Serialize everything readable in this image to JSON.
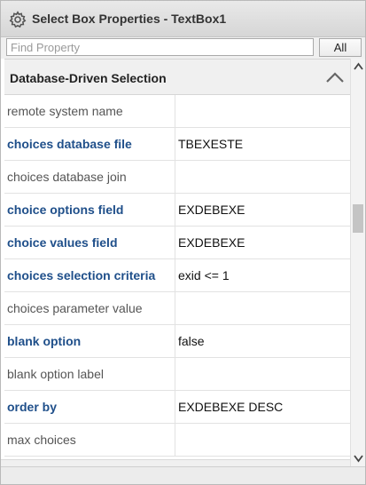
{
  "window": {
    "title": "Select Box Properties - TextBox1",
    "icon": "gear-icon"
  },
  "search": {
    "placeholder": "Find Property",
    "value": "",
    "all_button_label": "All"
  },
  "section": {
    "title": "Database-Driven Selection",
    "collapse_icon": "chevron-up-icon",
    "expanded": true
  },
  "properties": [
    {
      "name": "remote system name",
      "value": "",
      "bold": false
    },
    {
      "name": "choices database file",
      "value": "TBEXESTE",
      "bold": true
    },
    {
      "name": "choices database join",
      "value": "",
      "bold": false
    },
    {
      "name": "choice options field",
      "value": "EXDEBEXE",
      "bold": true
    },
    {
      "name": "choice values field",
      "value": "EXDEBEXE",
      "bold": true
    },
    {
      "name": "choices selection criteria",
      "value": "exid <= 1",
      "bold": true
    },
    {
      "name": "choices parameter value",
      "value": "",
      "bold": false
    },
    {
      "name": "blank option",
      "value": "false",
      "bold": true
    },
    {
      "name": "blank option label",
      "value": "",
      "bold": false
    },
    {
      "name": "order by",
      "value": "EXDEBEXE DESC",
      "bold": true
    },
    {
      "name": "max choices",
      "value": "",
      "bold": false
    }
  ],
  "colors": {
    "modified_property": "#1f4f8a",
    "default_property": "#555555"
  }
}
